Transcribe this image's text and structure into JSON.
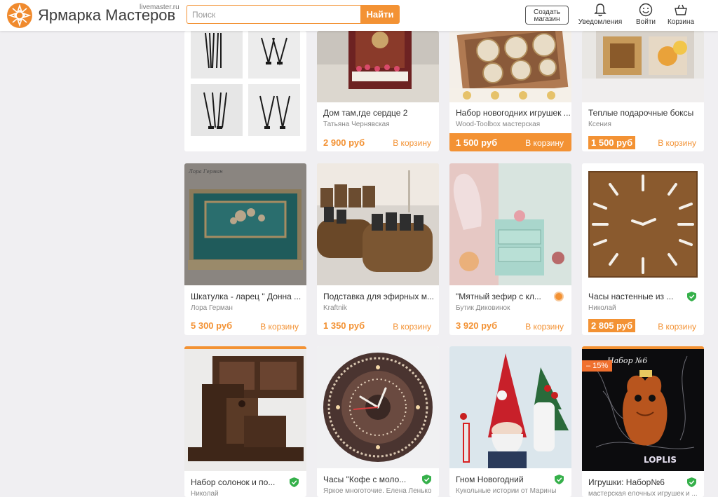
{
  "header": {
    "brand": "Ярмарка Мастеров",
    "brand_sub": "livemaster.ru",
    "search_placeholder": "Поиск",
    "search_button": "Найти",
    "create_shop": "Создать магазин",
    "notifications": "Уведомления",
    "login": "Войти",
    "cart": "Корзина"
  },
  "colors": {
    "accent": "#f39234",
    "verified": "#35b04a"
  },
  "products": [
    {
      "title": "",
      "shop": "",
      "price": "",
      "cart": ""
    },
    {
      "title": "Дом там,где сердце 2",
      "shop": "Татьяна Чернявская",
      "price": "2 900 руб",
      "cart": "В корзину"
    },
    {
      "title": "Набор новогодних игрушек ...",
      "shop": "Wood-Toolbox мастерская",
      "price": "1 500 руб",
      "cart": "В корзину"
    },
    {
      "title": "Теплые подарочные боксы",
      "shop": "Ксения",
      "price": "1 500 руб",
      "cart": "В корзину"
    },
    {
      "title": "Шкатулка - ларец \" Донна ...",
      "shop": "Лора Герман",
      "price": "5 300 руб",
      "cart": "В корзину"
    },
    {
      "title": "Подставка для эфирных м...",
      "shop": "Kraftnik",
      "price": "1 350 руб",
      "cart": "В корзину"
    },
    {
      "title": "\"Мятный зефир с кл...",
      "shop": "Бутик Диковинок",
      "price": "3 920 руб",
      "cart": "В корзину"
    },
    {
      "title": "Часы настенные из ...",
      "shop": "Николай",
      "price": "2 805 руб",
      "cart": "В корзину"
    },
    {
      "title": "Набор солонок и по...",
      "shop": "Николай"
    },
    {
      "title": "Часы \"Кофе с моло...",
      "shop": "Яркое многоточие. Елена Ленько"
    },
    {
      "title": "Гном Новогодний",
      "shop": "Кукольные истории от Марины"
    },
    {
      "title": "Игрушки: Набор№6",
      "shop": "мастерская елочных игрушек и ...",
      "discount": "– 15%"
    }
  ],
  "image_texts": {
    "card4_sig": "Лора Герман",
    "card11_sign": "Набор №6",
    "card11_mark": "LOPLIS"
  }
}
